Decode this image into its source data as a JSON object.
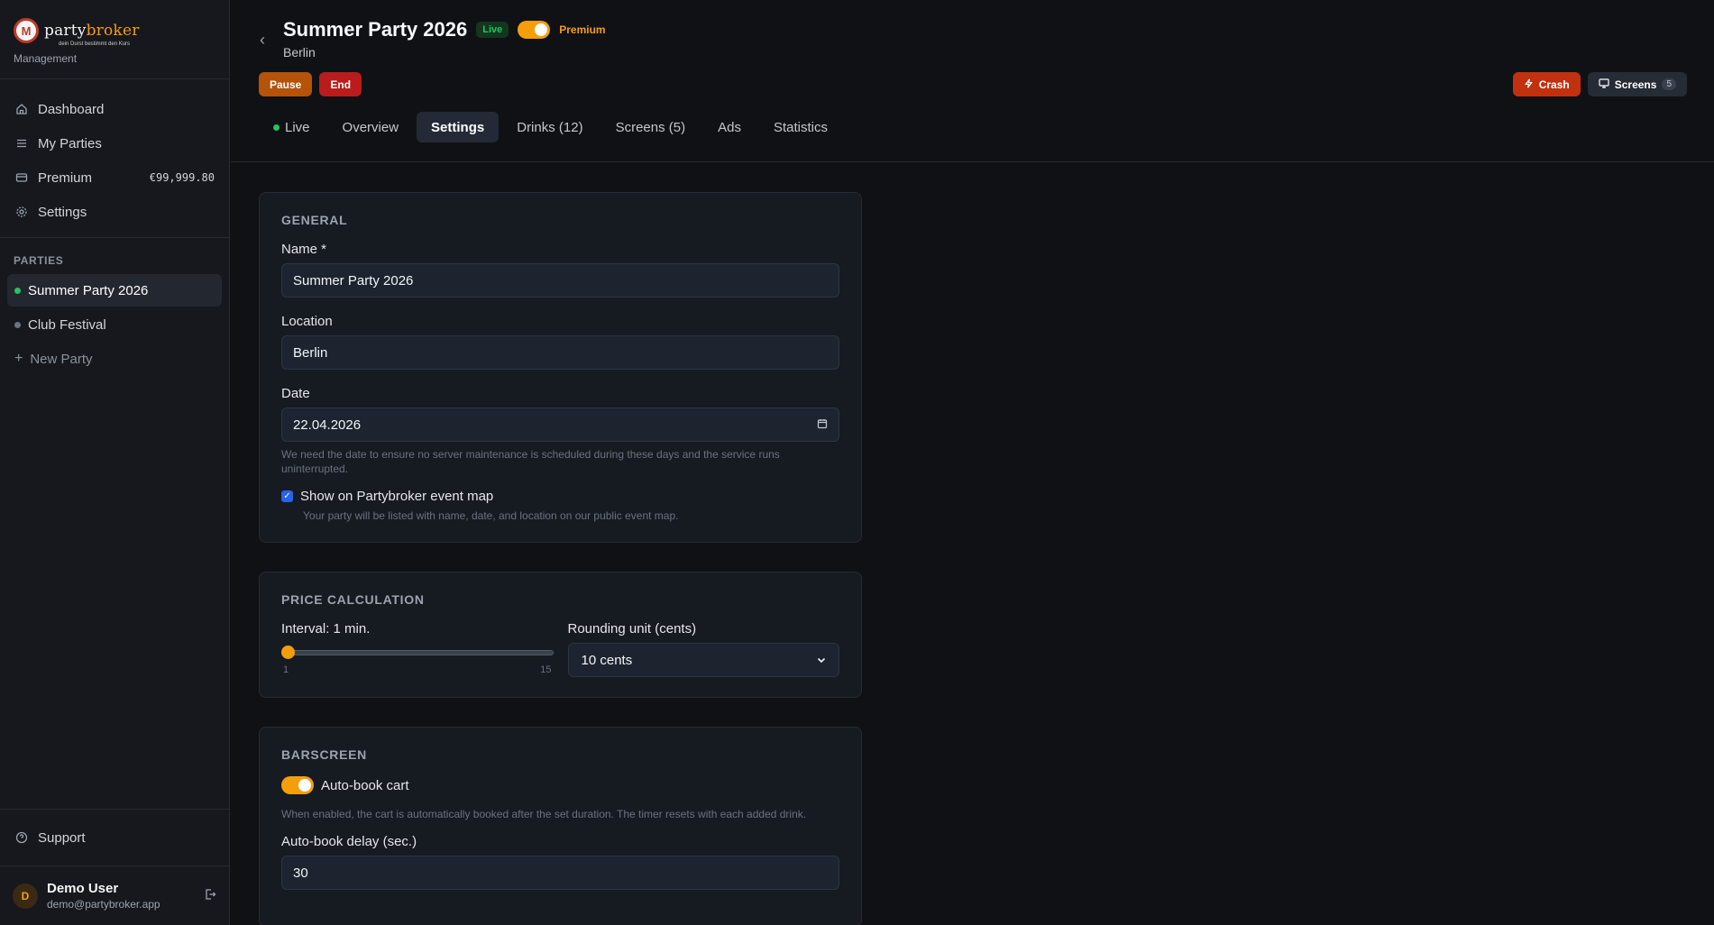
{
  "brand": {
    "logo_text_a": "party",
    "logo_text_b": "broker",
    "tagline": "dein Durst bestimmt den Kurs",
    "subtitle": "Management"
  },
  "nav": [
    {
      "label": "Dashboard",
      "icon": "home-icon"
    },
    {
      "label": "My Parties",
      "icon": "list-icon"
    },
    {
      "label": "Premium",
      "icon": "card-icon",
      "value": "€99,999.80"
    },
    {
      "label": "Settings",
      "icon": "gear-icon"
    }
  ],
  "parties": {
    "heading": "PARTIES",
    "items": [
      {
        "label": "Summer Party 2026",
        "status": "live",
        "active": true
      },
      {
        "label": "Club Festival",
        "status": "inactive",
        "active": false
      }
    ],
    "new_label": "New Party"
  },
  "support_label": "Support",
  "user": {
    "initial": "D",
    "name": "Demo User",
    "email": "demo@partybroker.app"
  },
  "header": {
    "title": "Summer Party 2026",
    "live_badge": "Live",
    "premium_label": "Premium",
    "premium_enabled": true,
    "location": "Berlin",
    "pause_label": "Pause",
    "end_label": "End",
    "crash_label": "Crash",
    "screens_label": "Screens",
    "screens_count": "5"
  },
  "tabs": [
    {
      "label": "Live",
      "active": false
    },
    {
      "label": "Overview",
      "active": false
    },
    {
      "label": "Settings",
      "active": true
    },
    {
      "label": "Drinks (12)",
      "active": false
    },
    {
      "label": "Screens (5)",
      "active": false
    },
    {
      "label": "Ads",
      "active": false
    },
    {
      "label": "Statistics",
      "active": false
    }
  ],
  "general": {
    "title": "GENERAL",
    "name_label": "Name *",
    "name_value": "Summer Party 2026",
    "location_label": "Location",
    "location_value": "Berlin",
    "date_label": "Date",
    "date_value": "22.04.2026",
    "date_help": "We need the date to ensure no server maintenance is scheduled during these days and the service runs uninterrupted.",
    "map_label": "Show on Partybroker event map",
    "map_checked": true,
    "map_help": "Your party will be listed with name, date, and location on our public event map."
  },
  "price": {
    "title": "PRICE CALCULATION",
    "interval_label": "Interval: 1 min.",
    "interval_value": 1,
    "interval_min": "1",
    "interval_max": "15",
    "rounding_label": "Rounding unit (cents)",
    "rounding_value": "10 cents"
  },
  "barscreen": {
    "title": "BARSCREEN",
    "autobook_label": "Auto-book cart",
    "autobook_enabled": true,
    "autobook_help": "When enabled, the cart is automatically booked after the set duration. The timer resets with each added drink.",
    "delay_label": "Auto-book delay (sec.)",
    "delay_value": "30"
  },
  "colors": {
    "accent": "#f59e0b",
    "live": "#22c55e",
    "danger": "#b91c1c"
  }
}
